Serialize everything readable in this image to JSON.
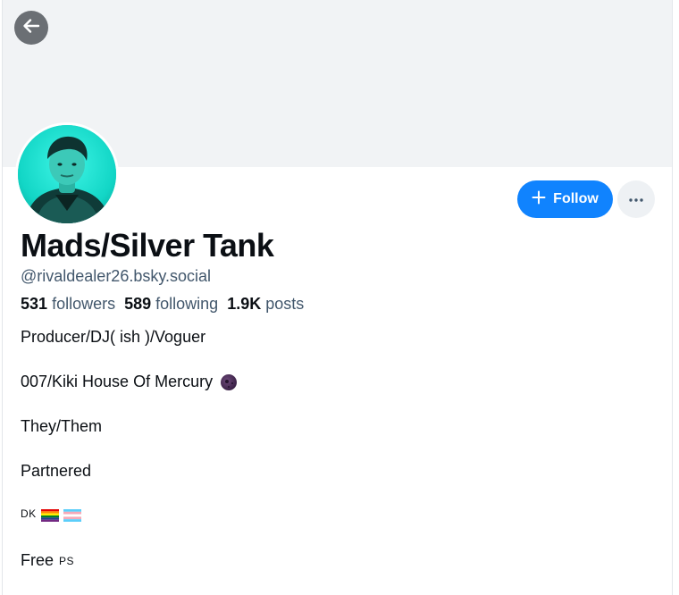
{
  "profile": {
    "display_name": "Mads/Silver Tank",
    "handle": "@rivaldealer26.bsky.social"
  },
  "actions": {
    "follow_label": "Follow",
    "more_label": "..."
  },
  "stats": {
    "followers_count": "531",
    "followers_label": "followers",
    "following_count": "589",
    "following_label": "following",
    "posts_count": "1.9K",
    "posts_label": "posts"
  },
  "bio": {
    "line1": "Producer/DJ( ish )/Voguer",
    "line2": "007/Kiki House Of Mercury",
    "line3": "They/Them",
    "line4": "Partnered",
    "line5": "DK",
    "line6_word": "Free",
    "line6_small": "PS"
  },
  "icons": {
    "back": "arrow-left-icon",
    "plus": "plus-icon",
    "more": "ellipsis-icon",
    "moon": "new-moon-emoji-icon",
    "flag_rainbow": "rainbow-flag-icon",
    "flag_trans": "transgender-flag-icon"
  },
  "colors": {
    "accent": "#1083fe",
    "banner": "#f1f3f5",
    "muted_text": "#42576c",
    "avatar_bg": "#1fd8c8"
  }
}
